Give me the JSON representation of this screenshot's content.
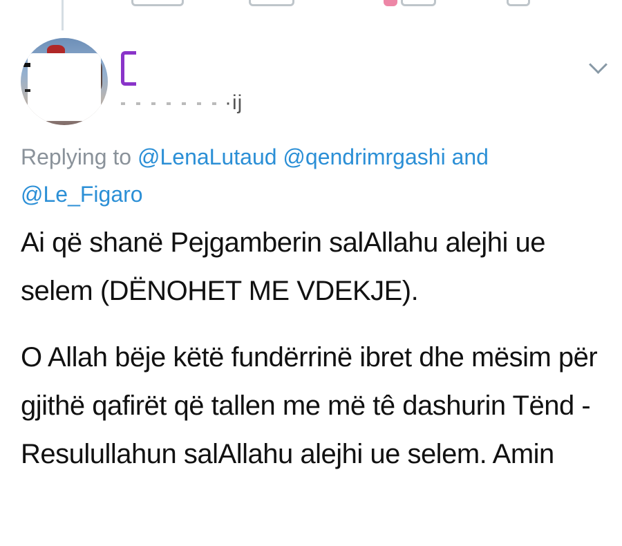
{
  "tweet": {
    "handle_fragment": "·ij",
    "replying": {
      "prefix": "Replying to",
      "mentions": [
        "@LenaLutaud",
        "@qendrimrgashi"
      ],
      "conjunction": "and",
      "last_mention": "@Le_Figaro"
    },
    "paragraphs": [
      "Ai që shanë Pejgamberin salAllahu alejhi ue selem (DËNOHET ME VDEKJE).",
      "O Allah bëje këtë fundërrinë ibret dhe mësim për gjithë qafirët që tallen me më tê dashurin Tënd - Resulullahun salAllahu alejhi ue selem. Amin"
    ]
  },
  "colors": {
    "mention": "#2b8fd6",
    "muted": "#8a929a",
    "text": "#111111"
  }
}
